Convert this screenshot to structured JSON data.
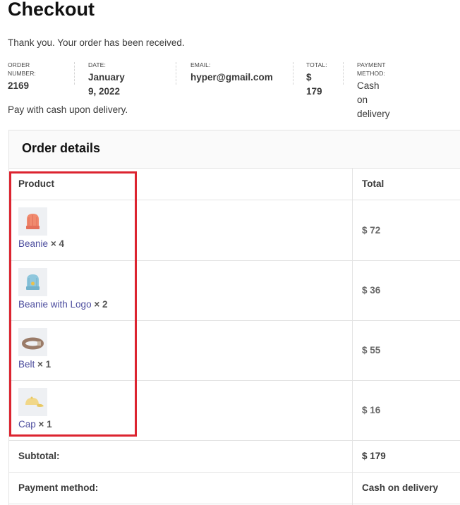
{
  "page": {
    "title": "Checkout",
    "thank_you": "Thank you. Your order has been received.",
    "payment_note": "Pay with cash upon delivery."
  },
  "overview": {
    "order_number": {
      "label": "ORDER NUMBER:",
      "value": "2169"
    },
    "date": {
      "label": "DATE:",
      "value": "January 9, 2022"
    },
    "email": {
      "label": "EMAIL:",
      "value": "hyper@gmail.com"
    },
    "total": {
      "label": "TOTAL:",
      "value": "$ 179"
    },
    "payment_method": {
      "label": "PAYMENT METHOD:",
      "value": "Cash on delivery"
    }
  },
  "order_details": {
    "title": "Order details",
    "columns": {
      "product": "Product",
      "total": "Total"
    },
    "items": [
      {
        "name": "Beanie",
        "qty": "× 4",
        "total": "$ 72",
        "icon": "beanie-icon",
        "color": "#f08a6e"
      },
      {
        "name": "Beanie with Logo",
        "qty": "× 2",
        "total": "$ 36",
        "icon": "beanie-logo-icon",
        "color": "#8fc7dd"
      },
      {
        "name": "Belt",
        "qty": "× 1",
        "total": "$ 55",
        "icon": "belt-icon",
        "color": "#9a7b68"
      },
      {
        "name": "Cap",
        "qty": "× 1",
        "total": "$ 16",
        "icon": "cap-icon",
        "color": "#f1d788"
      }
    ],
    "subtotal": {
      "label": "Subtotal:",
      "value": "$ 179"
    },
    "payment_method": {
      "label": "Payment method:",
      "value": "Cash on delivery"
    }
  },
  "colors": {
    "link": "#4b4c9e",
    "highlight": "#dc2430",
    "border": "#e3e3e3"
  }
}
